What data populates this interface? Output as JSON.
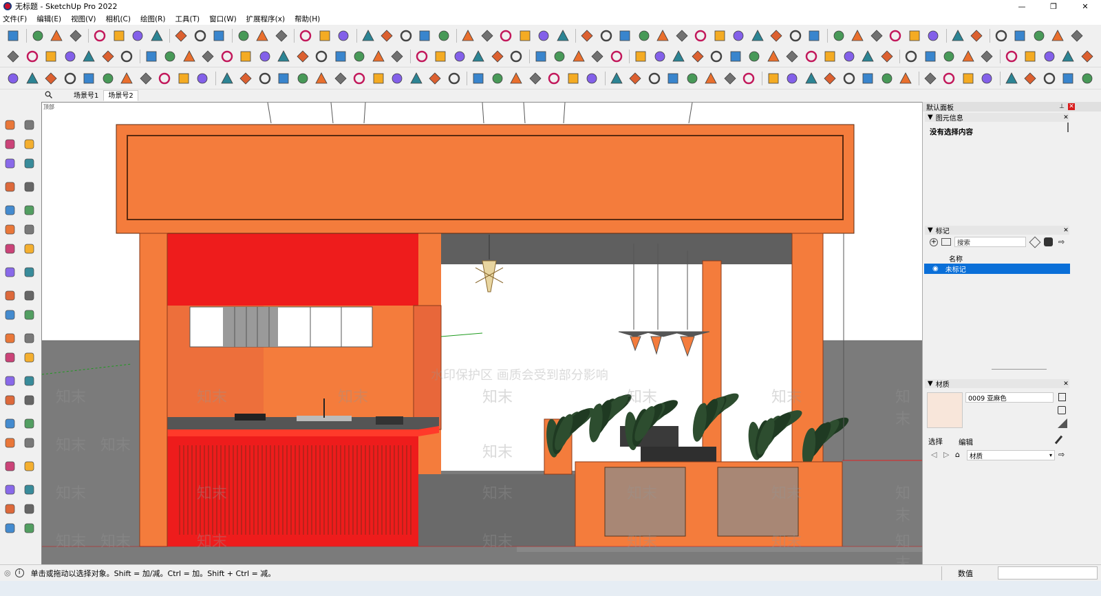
{
  "window": {
    "title": "无标题 - SketchUp Pro 2022",
    "minimize": "—",
    "maximize": "❐",
    "close": "✕"
  },
  "menu": [
    "文件(F)",
    "编辑(E)",
    "视图(V)",
    "相机(C)",
    "绘图(R)",
    "工具(T)",
    "窗口(W)",
    "扩展程序(x)",
    "帮助(H)"
  ],
  "scene_tabs": {
    "search_icon": "search-icon",
    "tabs": [
      "场景号1",
      "场景号2"
    ],
    "active_index": 1
  },
  "viewport": {
    "corner_label": "顶部",
    "watermark_text": "知末",
    "watermark_banner": "水印保护区   画质会受到部分影响",
    "colors": {
      "canopy": "#f47c3c",
      "red_wall": "#ee1c1c",
      "ground": "#777777",
      "sky": "#ffffff"
    }
  },
  "default_panel": {
    "title": "默认面板",
    "pin_icon": "pin-icon",
    "entity_info": {
      "title": "图元信息",
      "message": "没有选择内容"
    },
    "tags": {
      "title": "标记",
      "search_placeholder": "搜索",
      "column_name": "名称",
      "rows": [
        {
          "name": "未标记",
          "selected": true
        }
      ]
    },
    "materials": {
      "title": "材质",
      "current_material": "0009 亚麻色",
      "swatch_color": "#f8e6da",
      "tab_select": "选择",
      "tab_edit": "编辑",
      "library_select": "材质"
    }
  },
  "status": {
    "message": "单击或拖动以选择对象。Shift = 加/减。Ctrl = 加。Shift + Ctrl = 减。",
    "measurements_label": "数值"
  }
}
